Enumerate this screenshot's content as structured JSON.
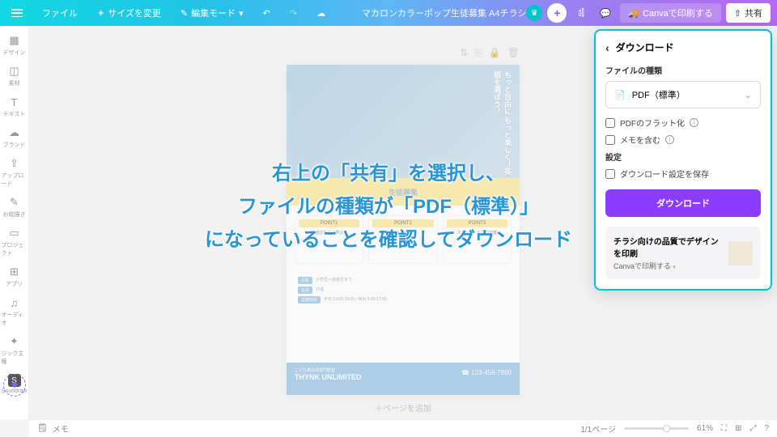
{
  "topbar": {
    "file": "ファイル",
    "resize": "サイズを変更",
    "edit_mode": "編集モード",
    "doc_title": "マカロンカラーポップ生徒募集 A4チラシ",
    "print": "Canvaで印刷する",
    "share": "共有"
  },
  "sidebar": {
    "items": [
      "デザイン",
      "素材",
      "テキスト",
      "ブランド",
      "アップロード",
      "お絵描き",
      "プロジェクト",
      "アプリ",
      "オーディオ",
      "ジック主権",
      "Soundraw"
    ]
  },
  "canvas": {
    "add_page": "＋ページを追加",
    "flyer": {
      "banner": "生徒募集",
      "cards": [
        {
          "hdr": "POINT1",
          "title": "遊びながら学ぶ"
        },
        {
          "hdr": "POINT2",
          "title": "少人数制"
        },
        {
          "hdr": "POINT3",
          "title": "スケジュール調整可能"
        }
      ],
      "tags": [
        "対象",
        "定員",
        "営業時間"
      ],
      "tag_vals": [
        "小学生～高校生まで",
        "15名",
        "平日 13:00-19:00 / 休日 9:00-17:00"
      ],
      "footer_brand": "THYNK UNLIMITED",
      "footer_sub": "こども英会話専門教室",
      "footer_tel": "123-456-7890",
      "hero_v": "もっと自由に もっと楽しく！英語を選ぼう！"
    }
  },
  "panel": {
    "title": "ダウンロード",
    "filetype_label": "ファイルの種類",
    "filetype_value": "PDF（標準）",
    "flatten": "PDFのフラット化",
    "include_memo": "メモを含む",
    "settings_label": "設定",
    "save_settings": "ダウンロード設定を保存",
    "download_btn": "ダウンロード",
    "print_t1": "チラシ向けの品質でデザインを印刷",
    "print_t2": "Canvaで印刷する"
  },
  "bottombar": {
    "memo": "メモ",
    "page": "1/1ページ",
    "zoom": "61%"
  },
  "overlay": {
    "l1": "右上の「共有」を選択し、",
    "l2": "ファイルの種類が「PDF（標準）」",
    "l3": "になっていることを確認してダウンロード"
  }
}
